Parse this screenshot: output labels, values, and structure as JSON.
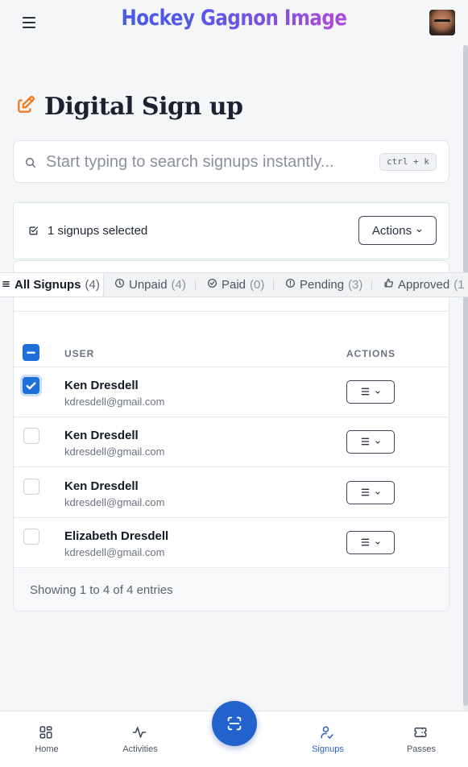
{
  "header": {
    "brand": "Hockey Gagnon Image"
  },
  "page": {
    "title": "Digital Sign up"
  },
  "search": {
    "placeholder": "Start typing to search signups instantly...",
    "value": "",
    "shortcut": "ctrl + k"
  },
  "selection": {
    "text": "1 signups selected",
    "actions_label": "Actions"
  },
  "tabs": [
    {
      "label": "All Signups",
      "count": "(4)",
      "active": true
    },
    {
      "label": "Unpaid",
      "count": "(4)"
    },
    {
      "label": "Paid",
      "count": "(0)"
    },
    {
      "label": "Pending",
      "count": "(3)"
    },
    {
      "label": "Approved",
      "count": "(1"
    }
  ],
  "table": {
    "columns": {
      "user": "USER",
      "actions": "ACTIONS"
    },
    "rows": [
      {
        "name": "Ken Dresdell",
        "email": "kdresdell@gmail.com",
        "selected": true
      },
      {
        "name": "Ken Dresdell",
        "email": "kdresdell@gmail.com",
        "selected": false
      },
      {
        "name": "Ken Dresdell",
        "email": "kdresdell@gmail.com",
        "selected": false
      },
      {
        "name": "Elizabeth Dresdell",
        "email": "kdresdell@gmail.com",
        "selected": false
      }
    ],
    "footer": "Showing 1 to 4 of 4 entries"
  },
  "bottom_nav": [
    {
      "label": "Home",
      "icon": "dashboard-icon"
    },
    {
      "label": "Activities",
      "icon": "activity-pulse-icon"
    },
    {
      "label": "Signups",
      "icon": "user-check-icon",
      "active": true
    },
    {
      "label": "Passes",
      "icon": "ticket-icon"
    }
  ],
  "colors": {
    "accent": "#1f6fd9",
    "scan_button": "#2262cc",
    "title_icon": "#f07b24",
    "active_nav": "#2d5fc4"
  }
}
